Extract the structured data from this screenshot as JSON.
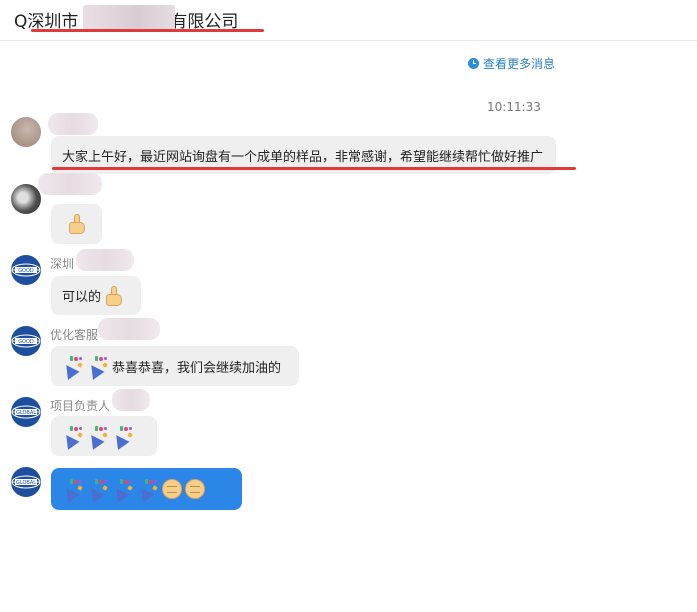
{
  "header": {
    "title_prefix": "Q深圳市",
    "title_suffix": "有限公司"
  },
  "more_messages": "查看更多消息",
  "timestamp": "10:11:33",
  "messages": [
    {
      "sender": "",
      "text": "大家上午好，最近网站询盘有一个成单的样品，非常感谢，希望能继续帮忙做好推广"
    },
    {
      "sender": "",
      "emoji": "thumbs-up"
    },
    {
      "sender": "深圳",
      "text": "可以的"
    },
    {
      "sender": "优化客服",
      "text": "恭喜恭喜，我们会继续加油的"
    },
    {
      "sender": "项目负责人",
      "emoji": "party-popper x3"
    },
    {
      "sender": "",
      "emoji": "party-popper x4 + fist x2"
    }
  ],
  "colors": {
    "accent_blue": "#2b86e8",
    "link_blue": "#2b7fc0",
    "highlight_red": "#e13a3a",
    "bubble_gray": "#efefef"
  }
}
